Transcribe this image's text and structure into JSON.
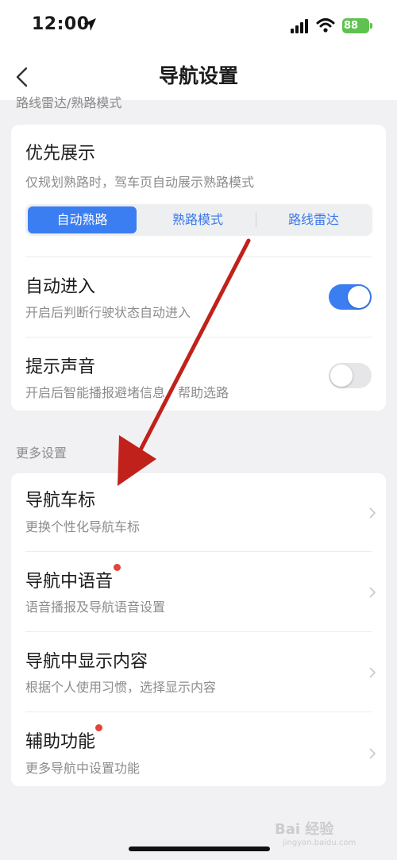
{
  "status_bar": {
    "time": "12:00",
    "battery": "88"
  },
  "nav": {
    "title": "导航设置"
  },
  "cut_section_header": "路线雷达/熟路模式",
  "priority_display": {
    "title": "优先展示",
    "subtitle": "仅规划熟路时，驾车页自动展示熟路模式",
    "options": [
      "自动熟路",
      "熟路模式",
      "路线雷达"
    ],
    "selected": "自动熟路"
  },
  "auto_enter": {
    "title": "自动进入",
    "subtitle": "开启后判断行驶状态自动进入",
    "enabled": true
  },
  "prompt_sound": {
    "title": "提示声音",
    "subtitle": "开启后智能播报避堵信息，帮助选路",
    "enabled": false
  },
  "more_settings": {
    "header": "更多设置",
    "items": [
      {
        "title": "导航车标",
        "subtitle": "更换个性化导航车标",
        "badge": false
      },
      {
        "title": "导航中语音",
        "subtitle": "语音播报及导航语音设置",
        "badge": true
      },
      {
        "title": "导航中显示内容",
        "subtitle": "根据个人使用习惯，选择显示内容",
        "badge": false
      },
      {
        "title": "辅助功能",
        "subtitle": "更多导航中设置功能",
        "badge": true
      }
    ]
  },
  "watermark": {
    "text": "Bai 经验",
    "sub": "jingyan.baidu.com"
  },
  "colors": {
    "accent": "#3b7ef2",
    "badge": "#e0463a",
    "annotation_arrow": "#c0221b"
  },
  "icons": [
    "location-arrow-icon",
    "signal-icon",
    "wifi-icon",
    "battery-icon",
    "back-icon",
    "chevron-right-icon"
  ]
}
